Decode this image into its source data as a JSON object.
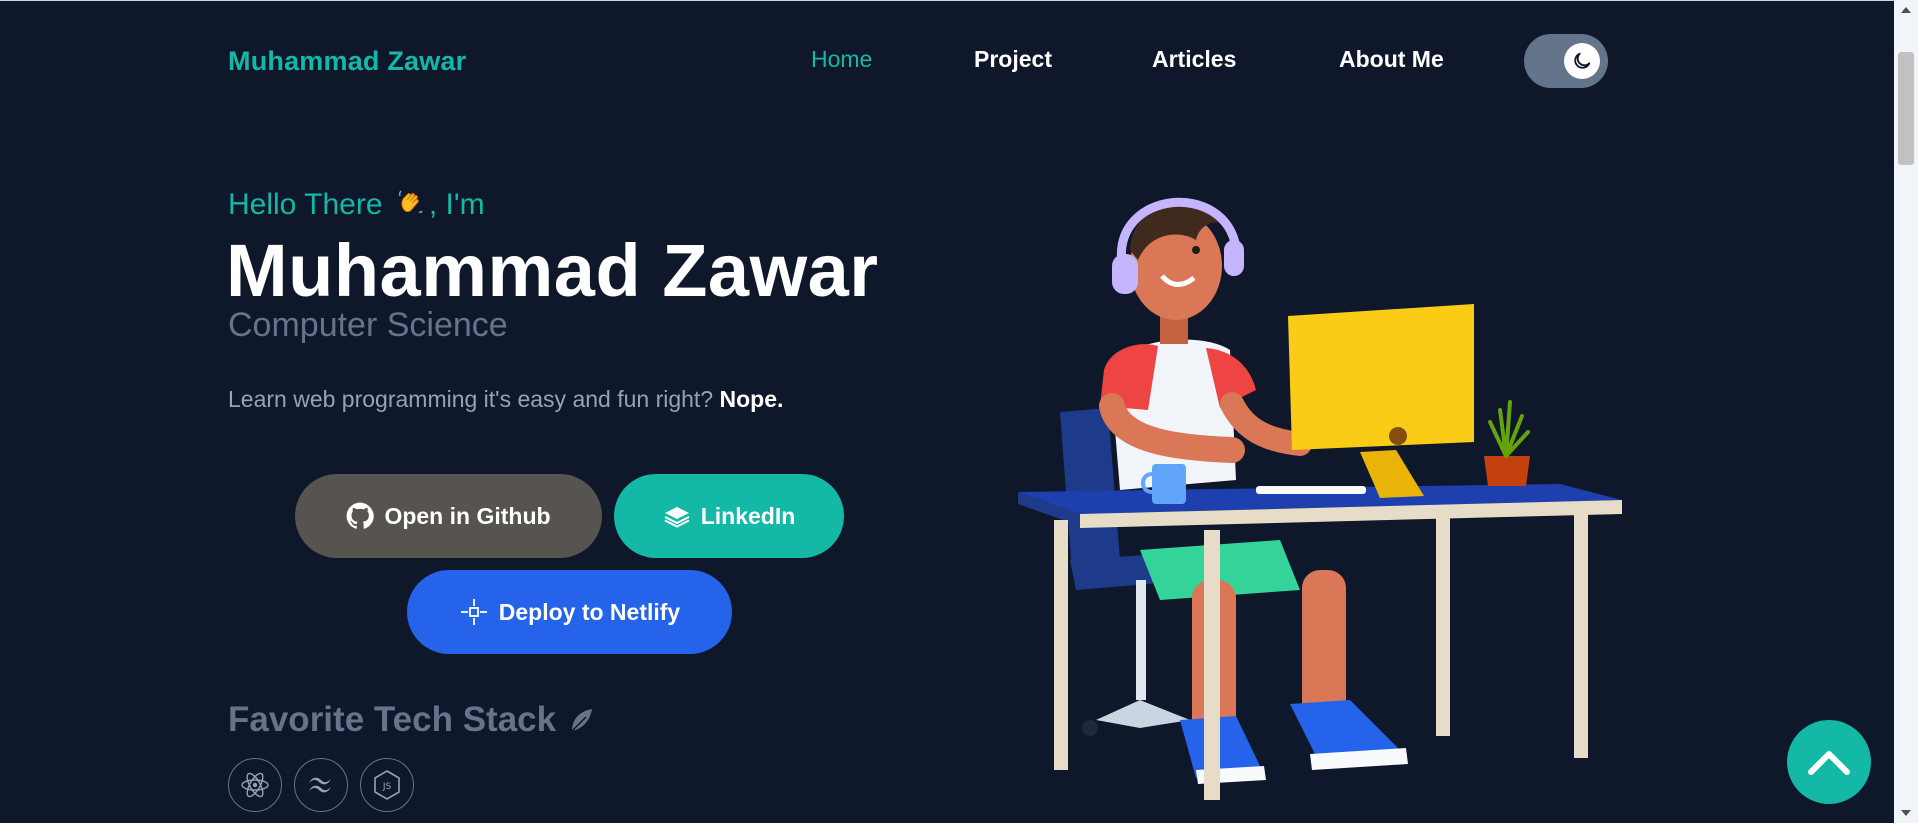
{
  "brand": "Muhammad Zawar",
  "nav": {
    "items": [
      {
        "label": "Home",
        "active": true
      },
      {
        "label": "Project",
        "active": false
      },
      {
        "label": "Articles",
        "active": false
      },
      {
        "label": "About Me",
        "active": false
      }
    ],
    "theme_toggle_icon": "moon-icon"
  },
  "hero": {
    "greeting_pre": "Hello There",
    "greeting_post": ", I'm",
    "name": "Muhammad Zawar",
    "role": "Computer Science",
    "tagline": "Learn web programming it's easy and fun right?",
    "tagline_emphasis": "Nope."
  },
  "buttons": {
    "github": {
      "label": "Open in Github",
      "icon": "github-icon"
    },
    "linkedin": {
      "label": "LinkedIn",
      "icon": "layers-icon"
    },
    "netlify": {
      "label": "Deploy to Netlify",
      "icon": "netlify-icon"
    }
  },
  "stack": {
    "title": "Favorite Tech Stack",
    "icons": [
      "react-icon",
      "tailwind-icon",
      "nodejs-icon"
    ]
  },
  "colors": {
    "background": "#0f172a",
    "accent": "#14b8a6",
    "muted": "#64748b",
    "github_button": "#57534e",
    "netlify_button": "#2563eb"
  }
}
